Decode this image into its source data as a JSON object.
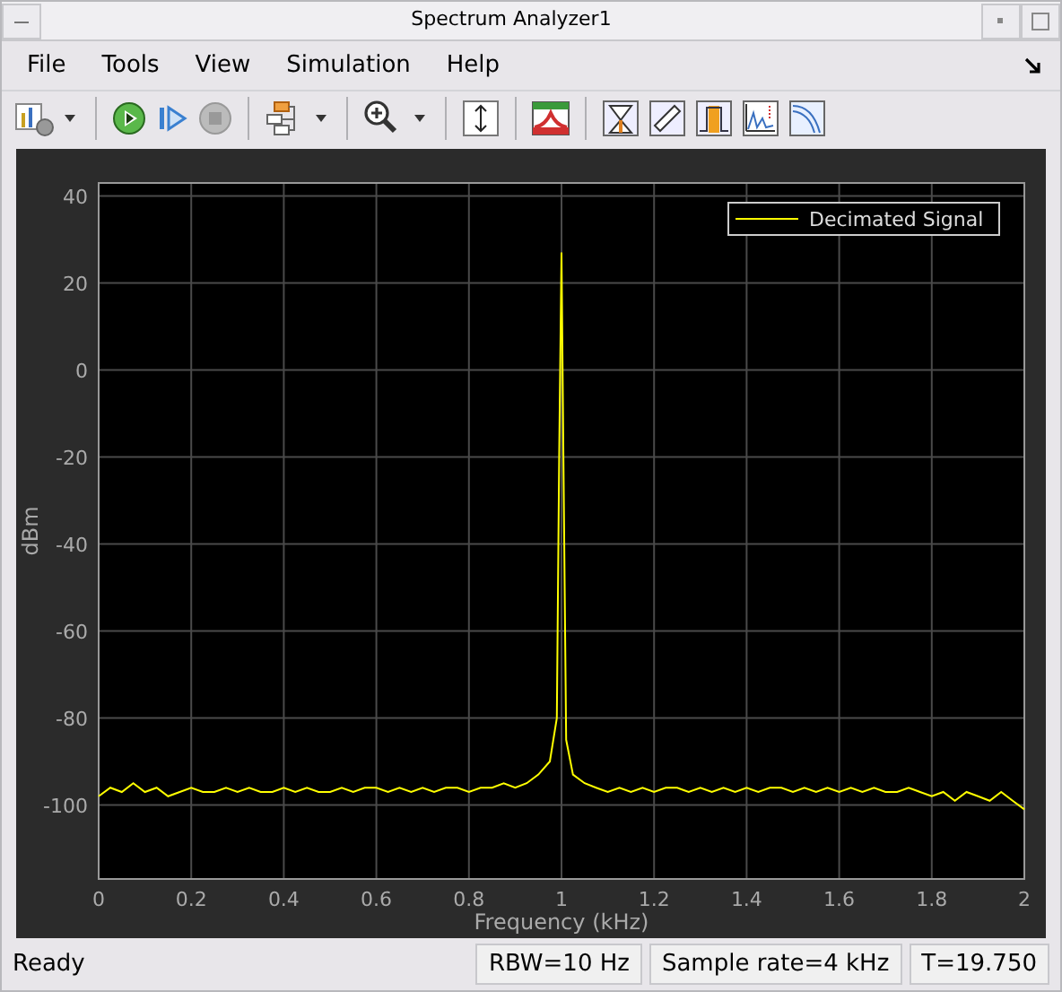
{
  "window": {
    "title": "Spectrum Analyzer1"
  },
  "menu": [
    "File",
    "Tools",
    "View",
    "Simulation",
    "Help"
  ],
  "plot": {
    "chart_data": {
      "type": "line",
      "xlabel": "Frequency (kHz)",
      "ylabel": "dBm",
      "x": [
        0,
        0.025,
        0.05,
        0.075,
        0.1,
        0.125,
        0.15,
        0.175,
        0.2,
        0.225,
        0.25,
        0.275,
        0.3,
        0.325,
        0.35,
        0.375,
        0.4,
        0.425,
        0.45,
        0.475,
        0.5,
        0.525,
        0.55,
        0.575,
        0.6,
        0.625,
        0.65,
        0.675,
        0.7,
        0.725,
        0.75,
        0.775,
        0.8,
        0.825,
        0.85,
        0.875,
        0.9,
        0.925,
        0.95,
        0.975,
        0.99,
        0.995,
        1.0,
        1.005,
        1.01,
        1.025,
        1.05,
        1.075,
        1.1,
        1.125,
        1.15,
        1.175,
        1.2,
        1.225,
        1.25,
        1.275,
        1.3,
        1.325,
        1.35,
        1.375,
        1.4,
        1.425,
        1.45,
        1.475,
        1.5,
        1.525,
        1.55,
        1.575,
        1.6,
        1.625,
        1.65,
        1.675,
        1.7,
        1.725,
        1.75,
        1.775,
        1.8,
        1.825,
        1.85,
        1.875,
        1.9,
        1.925,
        1.95,
        1.975,
        2
      ],
      "series": [
        {
          "name": "Decimated Signal",
          "color": "#ffff00",
          "values": [
            -98,
            -96,
            -97,
            -95,
            -97,
            -96,
            -98,
            -97,
            -96,
            -97,
            -97,
            -96,
            -97,
            -96,
            -97,
            -97,
            -96,
            -97,
            -96,
            -97,
            -97,
            -96,
            -97,
            -96,
            -96,
            -97,
            -96,
            -97,
            -96,
            -97,
            -96,
            -96,
            -97,
            -96,
            -96,
            -95,
            -96,
            -95,
            -93,
            -90,
            -80,
            -20,
            27,
            -30,
            -85,
            -93,
            -95,
            -96,
            -97,
            -96,
            -97,
            -96,
            -97,
            -96,
            -96,
            -97,
            -96,
            -97,
            -96,
            -97,
            -96,
            -97,
            -96,
            -96,
            -97,
            -96,
            -97,
            -96,
            -97,
            -96,
            -97,
            -96,
            -97,
            -97,
            -96,
            -97,
            -98,
            -97,
            -99,
            -97,
            -98,
            -99,
            -97,
            -99,
            -101
          ]
        }
      ],
      "grid": true,
      "xlim": [
        0,
        2
      ],
      "ylim": [
        -117,
        43
      ],
      "xticks": [
        0,
        0.2,
        0.4,
        0.6,
        0.8,
        1,
        1.2,
        1.4,
        1.6,
        1.8,
        2
      ],
      "yticks": [
        -100,
        -80,
        -60,
        -40,
        -20,
        0,
        20,
        40
      ]
    }
  },
  "status_bar": {
    "status": "Ready",
    "fields": [
      "RBW=10 Hz",
      "Sample rate=4 kHz",
      "T=19.750"
    ]
  }
}
